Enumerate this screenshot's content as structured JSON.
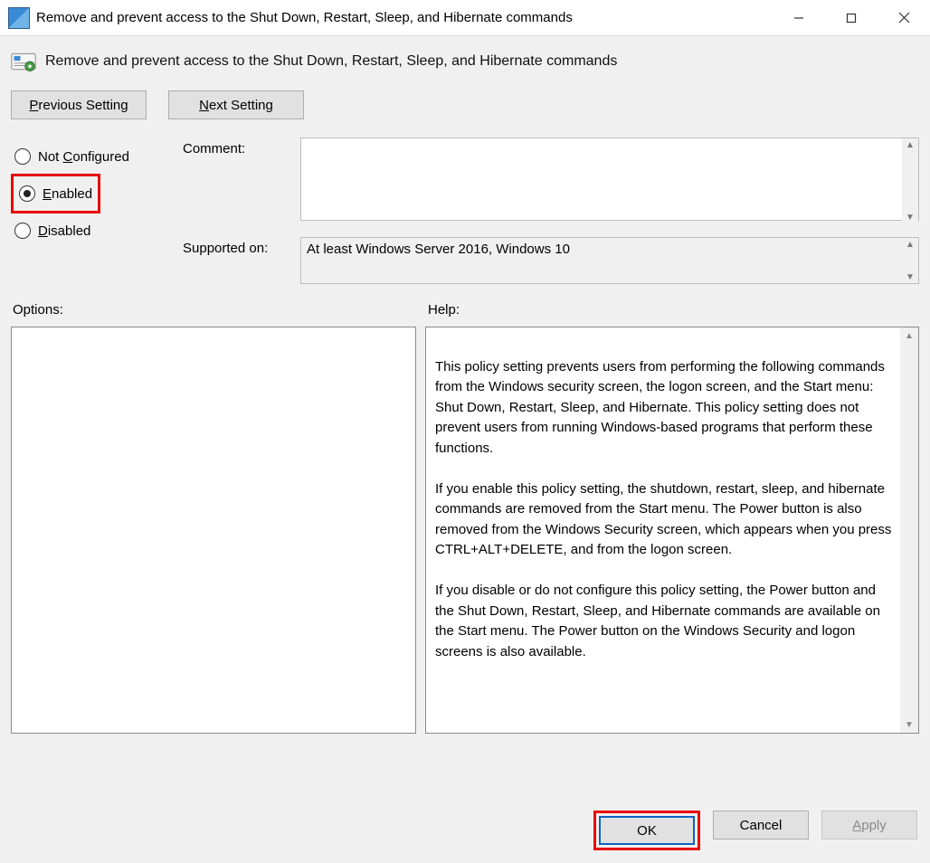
{
  "window": {
    "title": "Remove and prevent access to the Shut Down, Restart, Sleep, and Hibernate commands"
  },
  "header": {
    "policy_title": "Remove and prevent access to the Shut Down, Restart, Sleep, and Hibernate commands"
  },
  "nav": {
    "previous": "Previous Setting",
    "next": "Next Setting"
  },
  "state": {
    "not_configured": "Not Configured",
    "enabled": "Enabled",
    "disabled": "Disabled",
    "selected": "enabled"
  },
  "fields": {
    "comment_label": "Comment:",
    "comment_value": "",
    "supported_label": "Supported on:",
    "supported_value": "At least Windows Server 2016, Windows 10"
  },
  "sections": {
    "options_label": "Options:",
    "help_label": "Help:"
  },
  "help_text": "This policy setting prevents users from performing the following commands from the Windows security screen, the logon screen, and the Start menu: Shut Down, Restart, Sleep, and Hibernate. This policy setting does not prevent users from running Windows-based programs that perform these functions.\n\nIf you enable this policy setting, the shutdown, restart, sleep, and hibernate commands are removed from the Start menu. The Power button is also removed from the Windows Security screen, which appears when you press CTRL+ALT+DELETE, and from the logon screen.\n\nIf you disable or do not configure this policy setting, the Power button and the Shut Down, Restart, Sleep, and Hibernate commands are available on the Start menu. The Power button on the Windows Security and logon screens is also available.",
  "footer": {
    "ok": "OK",
    "cancel": "Cancel",
    "apply": "Apply"
  }
}
